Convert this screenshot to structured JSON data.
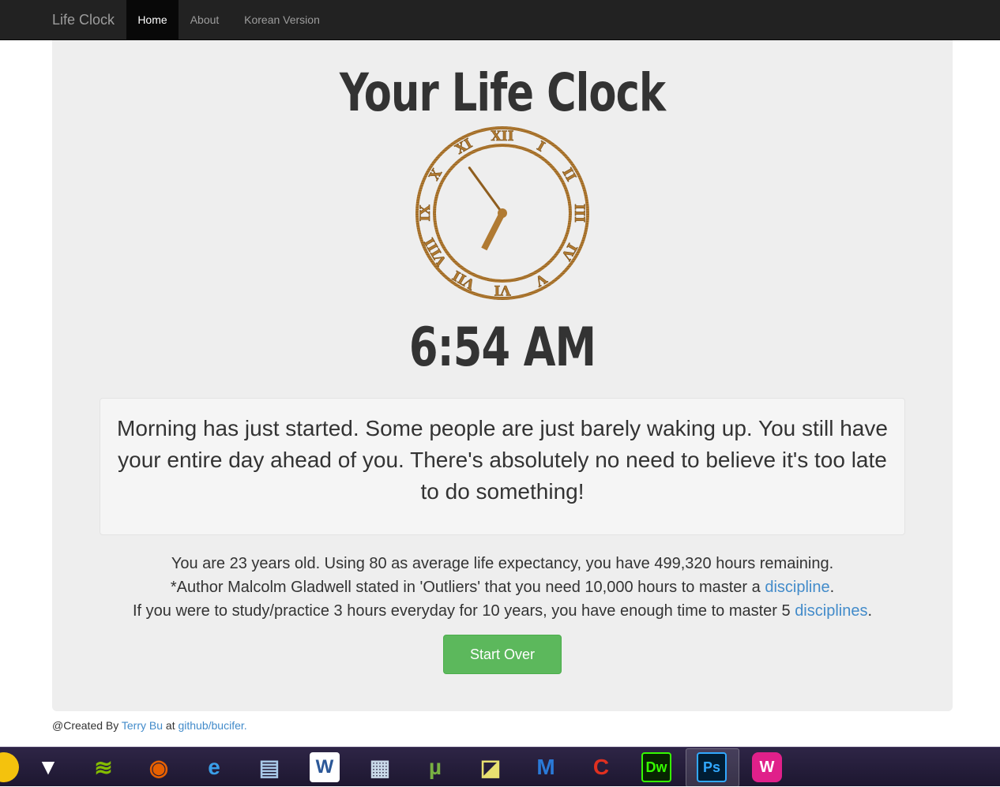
{
  "navbar": {
    "brand": "Life Clock",
    "items": [
      {
        "label": "Home",
        "active": true
      },
      {
        "label": "About",
        "active": false
      },
      {
        "label": "Korean Version",
        "active": false
      }
    ]
  },
  "main": {
    "title": "Your Life Clock",
    "clock": {
      "hour": 6,
      "minute": 54,
      "numerals": [
        "XII",
        "I",
        "II",
        "III",
        "IV",
        "V",
        "VI",
        "VII",
        "VIII",
        "IX",
        "X",
        "XI"
      ]
    },
    "time": "6:54 AM",
    "message": "Morning has just started. Some people are just barely waking up. You still have your entire day ahead of you. There's absolutely no need to believe it's too late to do something!",
    "info": {
      "line1": "You are 23 years old. Using 80 as average life expectancy, you have 499,320 hours remaining.",
      "line2_prefix": "*Author Malcolm Gladwell stated in 'Outliers' that you need 10,000 hours to master a ",
      "line2_link": "discipline",
      "line2_suffix": ".",
      "line3_prefix": "If you were to study/practice 3 hours everyday for 10 years, you have enough time to master 5 ",
      "line3_link": "disciplines",
      "line3_suffix": "."
    },
    "start_over": "Start Over"
  },
  "footer": {
    "prefix": "@Created By ",
    "author": "Terry Bu",
    "middle": " at ",
    "repo": "github/bucifer."
  },
  "taskbar": {
    "apps": [
      {
        "icon": "chrome-icon",
        "glyph": "",
        "color": "#f4c20d"
      },
      {
        "icon": "foobar-fox-icon",
        "glyph": "▼",
        "color": "#ffffff"
      },
      {
        "icon": "spotify-icon",
        "glyph": "≋",
        "color": "#84bd00"
      },
      {
        "icon": "firefox-icon",
        "glyph": "◉",
        "color": "#e66000"
      },
      {
        "icon": "internet-explorer-icon",
        "glyph": "e",
        "color": "#3a9fe8"
      },
      {
        "icon": "notepad-icon",
        "glyph": "▤",
        "color": "#a8c8e8"
      },
      {
        "icon": "word-icon",
        "glyph": "W",
        "color": "#2b5797"
      },
      {
        "icon": "calculator-icon",
        "glyph": "▦",
        "color": "#c8d8e8"
      },
      {
        "icon": "utorrent-icon",
        "glyph": "µ",
        "color": "#78b042"
      },
      {
        "icon": "sticky-notes-icon",
        "glyph": "◪",
        "color": "#e8e070"
      },
      {
        "icon": "malwarebytes-icon",
        "glyph": "M",
        "color": "#2a7ad8"
      },
      {
        "icon": "ccleaner-icon",
        "glyph": "C",
        "color": "#e03020"
      },
      {
        "icon": "dreamweaver-icon",
        "glyph": "Dw",
        "color": "#35fa00"
      },
      {
        "icon": "photoshop-icon",
        "glyph": "Ps",
        "color": "#31a8ff"
      },
      {
        "icon": "wamp-icon",
        "glyph": "W",
        "color": "#e0208a"
      }
    ]
  }
}
